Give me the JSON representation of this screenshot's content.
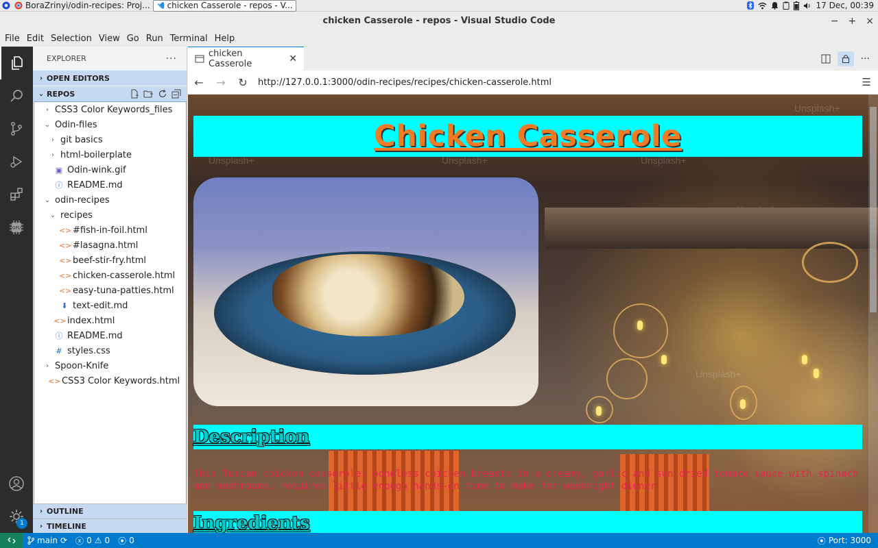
{
  "os_bar": {
    "tasks": [
      {
        "label": "BoraZrinyi/odin-recipes: Proj..."
      },
      {
        "label": "chicken Casserole - repos - V..."
      }
    ],
    "clock": "17 Dec, 00:39"
  },
  "window": {
    "title": "chicken Casserole - repos - Visual Studio Code",
    "controls": [
      "−",
      "+",
      "×"
    ]
  },
  "menu": [
    "File",
    "Edit",
    "Selection",
    "View",
    "Go",
    "Run",
    "Terminal",
    "Help"
  ],
  "activity_bar": {
    "items": [
      "files-icon",
      "search-icon",
      "source-control-icon",
      "run-debug-icon",
      "extensions-icon",
      "gpu-icon"
    ],
    "bottom": [
      "account-icon",
      "settings-icon"
    ],
    "settings_badge": "1"
  },
  "explorer": {
    "header": "EXPLORER",
    "more": "···",
    "open_editors": "OPEN EDITORS",
    "repos": "REPOS",
    "outline": "OUTLINE",
    "timeline": "TIMELINE",
    "tree": [
      {
        "label": "CSS3 Color Keywords_files",
        "type": "folder-closed",
        "depth": 0
      },
      {
        "label": "Odin-files",
        "type": "folder-open",
        "depth": 0
      },
      {
        "label": "git basics",
        "type": "folder-closed",
        "depth": 1
      },
      {
        "label": "html-boilerplate",
        "type": "folder-closed",
        "depth": 1
      },
      {
        "label": "Odin-wink.gif",
        "type": "image",
        "depth": 1
      },
      {
        "label": "README.md",
        "type": "info",
        "depth": 1
      },
      {
        "label": "odin-recipes",
        "type": "folder-open",
        "depth": 0
      },
      {
        "label": "recipes",
        "type": "folder-open",
        "depth": 1
      },
      {
        "label": "#fish-in-foil.html",
        "type": "html",
        "depth": 2
      },
      {
        "label": "#lasagna.html",
        "type": "html",
        "depth": 2
      },
      {
        "label": "beef-stir-fry.html",
        "type": "html",
        "depth": 2
      },
      {
        "label": "chicken-casserole.html",
        "type": "html",
        "depth": 2
      },
      {
        "label": "easy-tuna-patties.html",
        "type": "html",
        "depth": 2
      },
      {
        "label": "text-edit.md",
        "type": "markdown",
        "depth": 2
      },
      {
        "label": "index.html",
        "type": "html",
        "depth": 1
      },
      {
        "label": "README.md",
        "type": "info",
        "depth": 1
      },
      {
        "label": "styles.css",
        "type": "css",
        "depth": 1
      },
      {
        "label": "Spoon-Knife",
        "type": "folder-closed",
        "depth": 0
      },
      {
        "label": "CSS3 Color Keywords.html",
        "type": "html",
        "depth": 0
      }
    ]
  },
  "editor": {
    "tab_label": "chicken Casserole",
    "url": "http://127.0.0.1:3000/odin-recipes/recipes/chicken-casserole.html"
  },
  "page": {
    "title": "Chicken Casserole",
    "description_heading": "Description",
    "description": "This Tuscan chicken casserole, boneless chicken breasts in a creamy, garlic and sun-dried tomato sauce with spinach and mushrooms, requires little enough hands-on time to make for weeknight dinner",
    "ingredients_heading": "Ingredients",
    "watermark": "Unsplash+"
  },
  "status": {
    "branch": "main",
    "errors": "0",
    "warnings": "0",
    "ports": "0",
    "port_label": "Port: 3000"
  },
  "colors": {
    "accent": "#007acc",
    "page_band": "#00ffff",
    "title_text": "#f07b25",
    "desc_text": "#e4284e"
  }
}
